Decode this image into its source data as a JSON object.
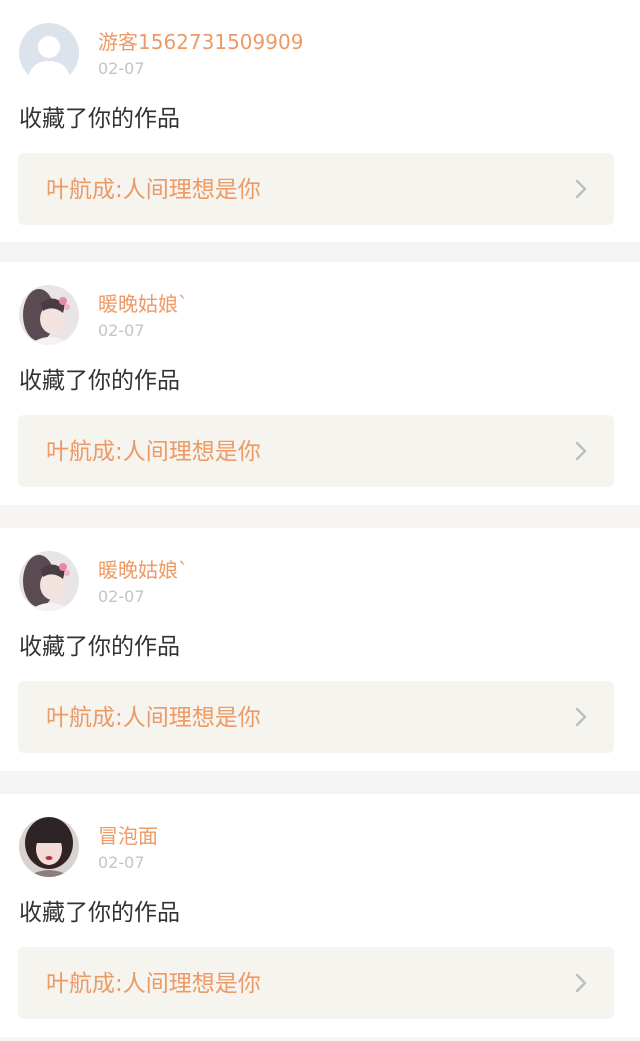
{
  "notifications": [
    {
      "user": "游客1562731509909",
      "date": "02-07",
      "action": "收藏了你的作品",
      "work_title": "叶航成:人间理想是你",
      "avatar_icon": "default-user-icon"
    },
    {
      "user": "暖晚姑娘`",
      "date": "02-07",
      "action": "收藏了你的作品",
      "work_title": "叶航成:人间理想是你",
      "avatar_icon": "user-photo-avatar"
    },
    {
      "user": "暖晚姑娘`",
      "date": "02-07",
      "action": "收藏了你的作品",
      "work_title": "叶航成:人间理想是你",
      "avatar_icon": "user-photo-avatar"
    },
    {
      "user": "冒泡面",
      "date": "02-07",
      "action": "收藏了你的作品",
      "work_title": "叶航成:人间理想是你",
      "avatar_icon": "user-photo-avatar"
    }
  ],
  "colors": {
    "accent": "#ed9a66",
    "text": "#333333",
    "muted": "#c4c4c4",
    "link_bg": "#f5f4ef",
    "page_bg": "#f6f5f4"
  }
}
